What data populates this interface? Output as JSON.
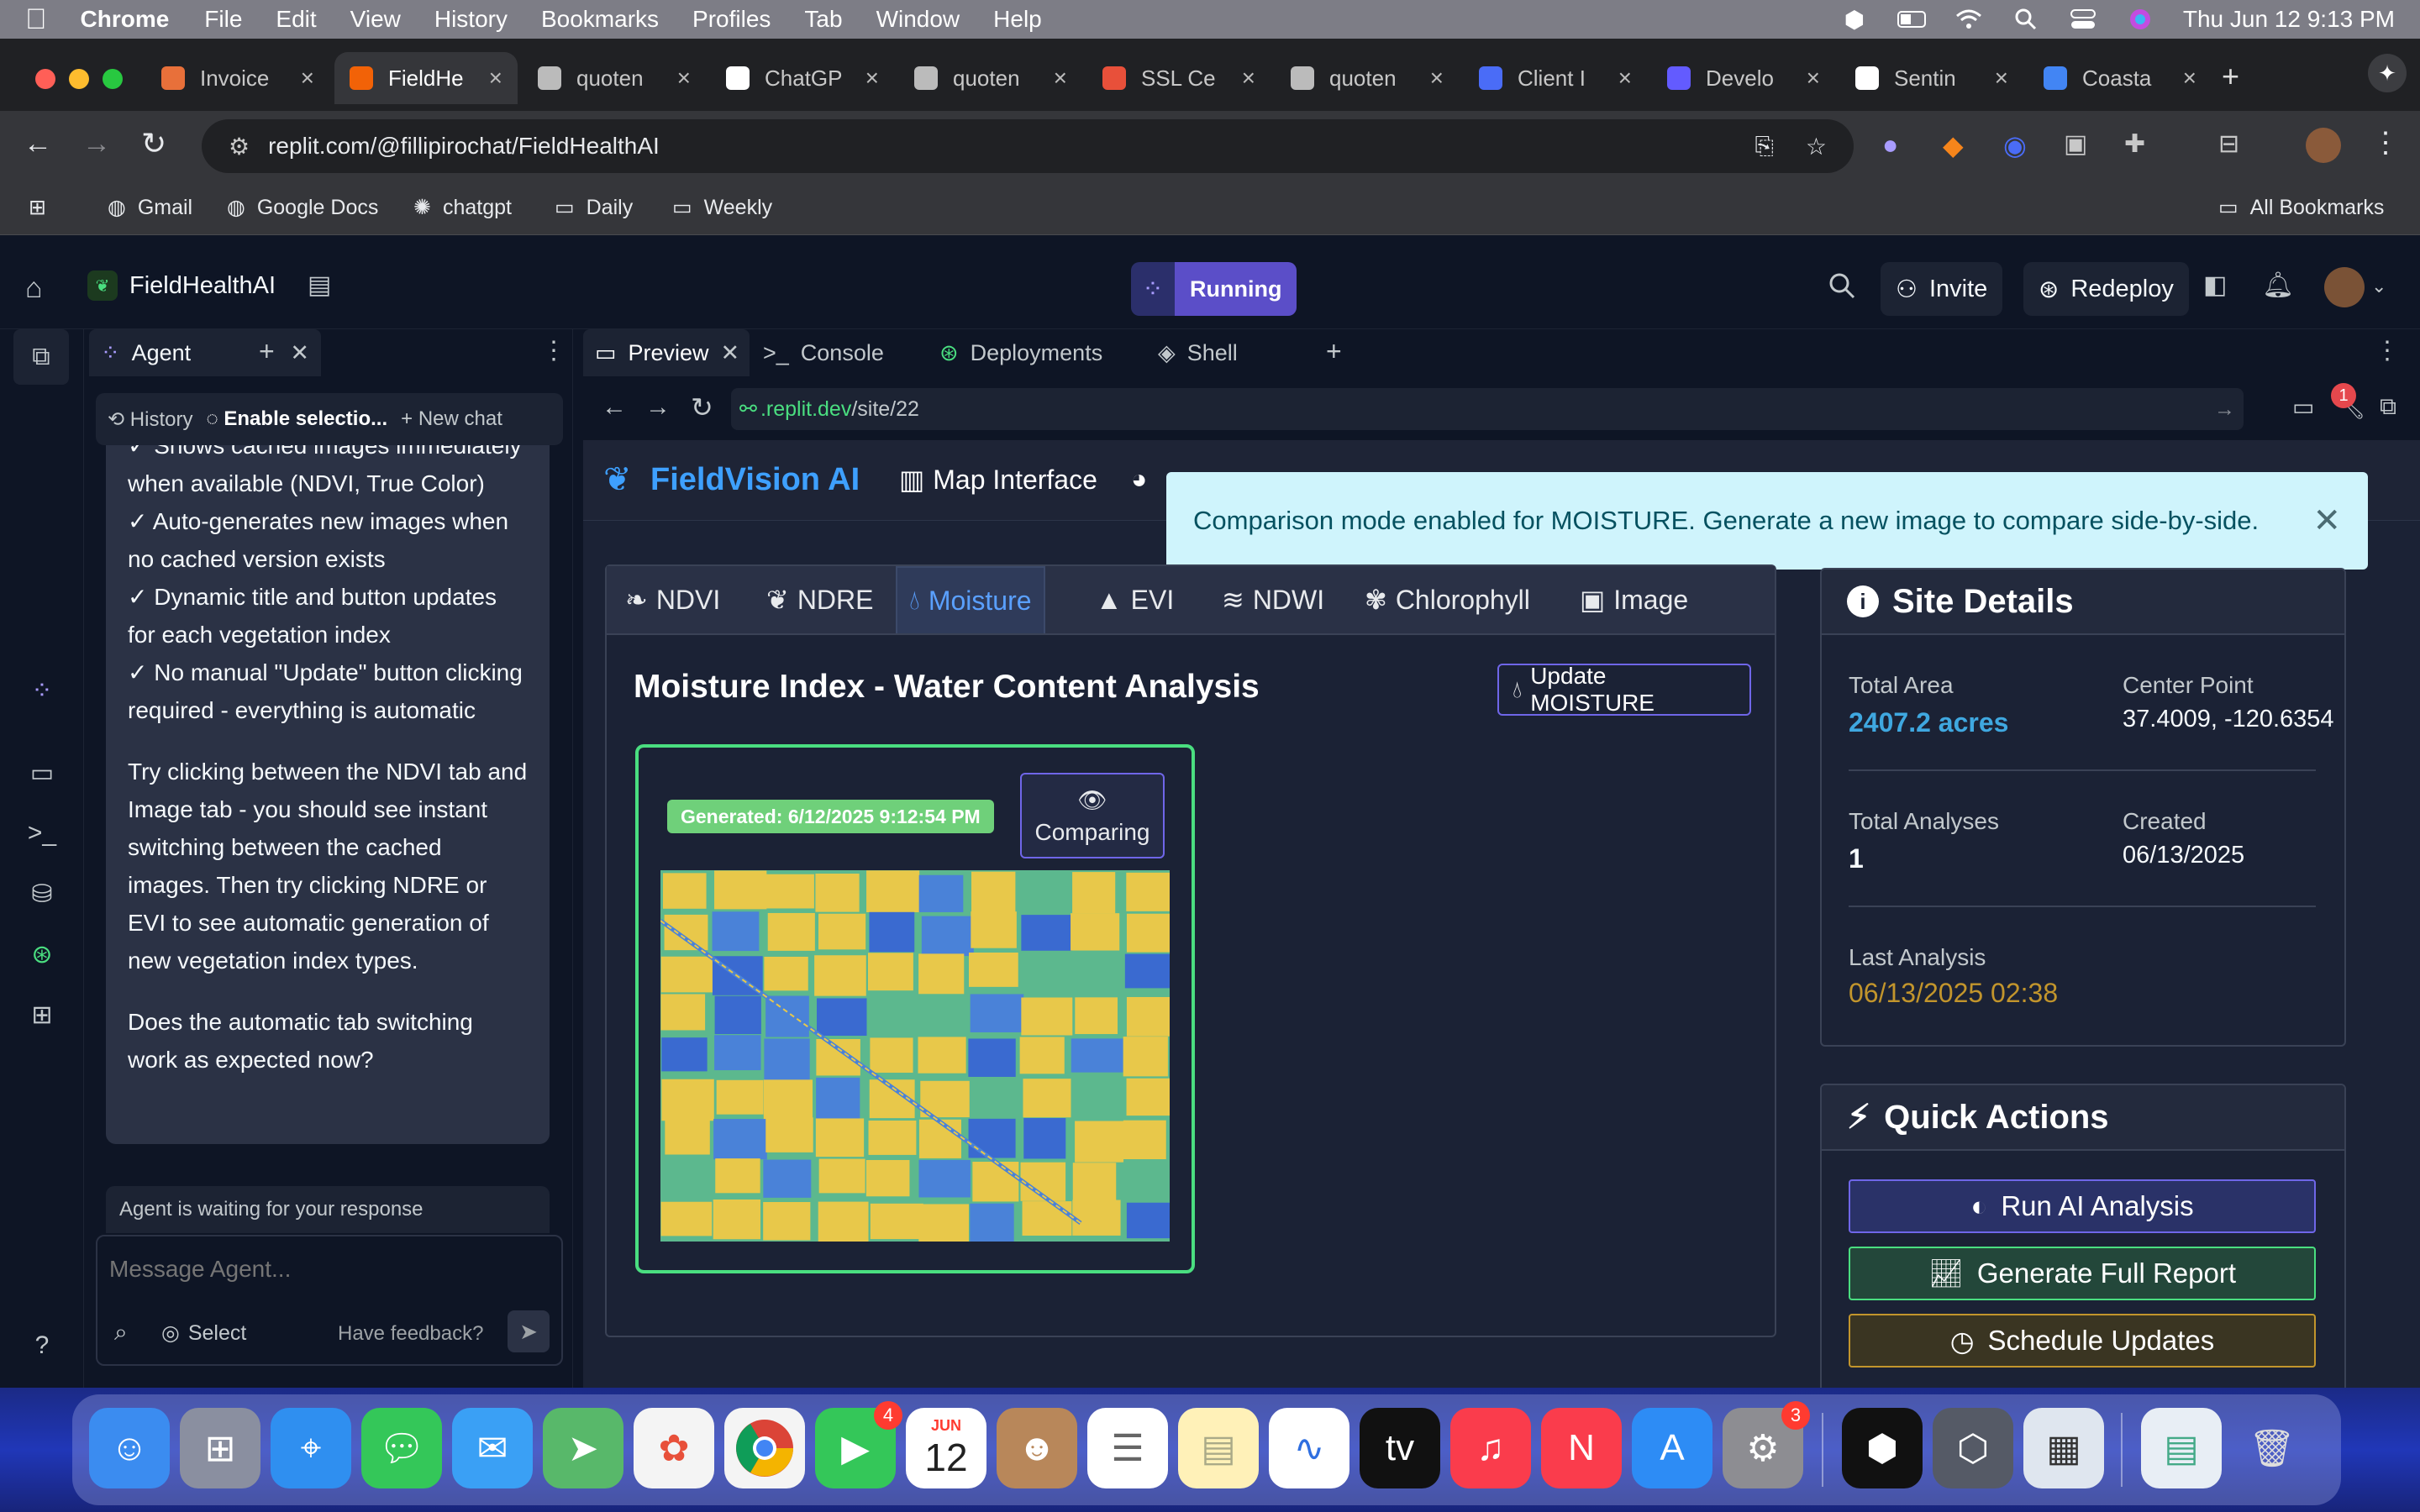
{
  "menubar": {
    "app": "Chrome",
    "items": [
      "File",
      "Edit",
      "View",
      "History",
      "Bookmarks",
      "Profiles",
      "Tab",
      "Window",
      "Help"
    ],
    "datetime": "Thu Jun 12  9:13 PM"
  },
  "browser": {
    "tabs": [
      {
        "label": "Invoice",
        "color": "#e8703a"
      },
      {
        "label": "FieldHe",
        "color": "#f26207"
      },
      {
        "label": "quoten",
        "color": "#bbbbbb"
      },
      {
        "label": "ChatGP",
        "color": "#ffffff"
      },
      {
        "label": "quoten",
        "color": "#bbbbbb"
      },
      {
        "label": "SSL Ce",
        "color": "#e8503a"
      },
      {
        "label": "quoten",
        "color": "#bbbbbb"
      },
      {
        "label": "Client I",
        "color": "#4a6cf7"
      },
      {
        "label": "Develo",
        "color": "#635bff"
      },
      {
        "label": "Sentin",
        "color": "#ffffff"
      },
      {
        "label": "Coasta",
        "color": "#4285f4"
      }
    ],
    "url": "replit.com/@fillipirochat/FieldHealthAI",
    "bookmarks": [
      "Gmail",
      "Google Docs",
      "chatgpt",
      "Daily",
      "Weekly"
    ],
    "all_bookmarks": "All Bookmarks"
  },
  "replit": {
    "project": "FieldHealthAI",
    "status": "Running",
    "invite": "Invite",
    "redeploy": "Redeploy",
    "agent_tab": "Agent",
    "toolbar": {
      "history": "History",
      "selection": "Enable selectio...",
      "new_chat": "New chat"
    },
    "agent_lines": [
      "✓ Shows cached images immediately when available (NDVI, True Color)",
      "✓ Auto-generates new images when no cached version exists",
      "✓ Dynamic title and button updates for each vegetation index",
      "✓ No manual \"Update\" button clicking required - everything is automatic"
    ],
    "agent_p1": "Try clicking between the NDVI tab and Image tab - you should see instant switching between the cached images. Then try clicking NDRE or EVI to see automatic generation of new vegetation index types.",
    "agent_p2": "Does the automatic tab switching work as expected now?",
    "waiting": "Agent is waiting for your response",
    "message_placeholder": "Message Agent...",
    "select": "Select",
    "feedback": "Have feedback?",
    "ws_tabs": [
      "Preview",
      "Console",
      "Deployments",
      "Shell"
    ],
    "preview_url_domain": ".replit.dev",
    "preview_url_path": "/site/22",
    "notif_count": "1"
  },
  "app": {
    "brand": "FieldVision AI",
    "nav_map": "Map Interface",
    "toast": "Comparison mode enabled for MOISTURE. Generate a new image to compare side-by-side.",
    "index_tabs": [
      "NDVI",
      "NDRE",
      "Moisture",
      "EVI",
      "NDWI",
      "Chlorophyll",
      "Image"
    ],
    "active_tab": "Moisture",
    "title": "Moisture Index - Water Content Analysis",
    "update_btn": "Update MOISTURE",
    "generated": "Generated: 6/12/2025 9:12:54 PM",
    "comparing": "Comparing",
    "site": {
      "heading": "Site Details",
      "total_area_label": "Total Area",
      "total_area": "2407.2 acres",
      "center_label": "Center Point",
      "center": "37.4009, -120.6354",
      "analyses_label": "Total Analyses",
      "analyses": "1",
      "created_label": "Created",
      "created": "06/13/2025",
      "last_label": "Last Analysis",
      "last": "06/13/2025 02:38"
    },
    "quick": {
      "heading": "Quick Actions",
      "run": "Run AI Analysis",
      "report": "Generate Full Report",
      "schedule": "Schedule Updates"
    }
  },
  "dock": {
    "calendar_month": "JUN",
    "calendar_day": "12",
    "facetime_badge": "4",
    "settings_badge": "3"
  }
}
